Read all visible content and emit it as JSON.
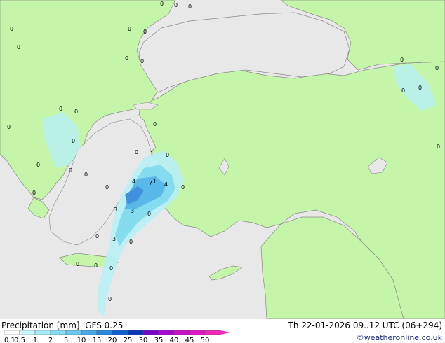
{
  "title": "Precipitation [mm]",
  "model": "GFS 0.25",
  "valid_time": "Th 22-01-2026 09..12 UTC (06+294)",
  "credit": "©weatheronline.co.uk",
  "colors": {
    "sea": "#e8e8e8",
    "land": "#c4f5a8",
    "border": "#8a8a8a",
    "precip_light": "#b8f0f5",
    "precip_mid": "#86dcef",
    "precip_heavy": "#58b8e8",
    "precip_core": "#4090e0"
  },
  "legend": {
    "ticks": [
      "0.1",
      "0.5",
      "1",
      "2",
      "5",
      "10",
      "15",
      "20",
      "25",
      "30",
      "35",
      "40",
      "45",
      "50"
    ],
    "colors": [
      "#ffffff",
      "#c8f8ff",
      "#a8ecf8",
      "#88dcf4",
      "#68c8f0",
      "#48a8e8",
      "#2888e0",
      "#1060d0",
      "#0838b8",
      "#7808c8",
      "#a808d0",
      "#c810c8",
      "#e018c0",
      "#f028b8"
    ]
  },
  "map_labels": [
    "0",
    "0",
    "0",
    "0",
    "0",
    "0",
    "0",
    "0",
    "0",
    "0",
    "0",
    "0",
    "0",
    "0",
    "0",
    "0",
    "0",
    "0",
    "0",
    "0",
    "0",
    "0",
    "0",
    "0",
    "0",
    "0",
    "0",
    "0",
    "0",
    "0",
    "0",
    "0",
    "0",
    "0",
    "1",
    "1",
    "4",
    "7",
    "4",
    "3",
    "3",
    "3",
    "0",
    "0",
    "0",
    "0",
    "0",
    "0",
    "0",
    "0"
  ]
}
